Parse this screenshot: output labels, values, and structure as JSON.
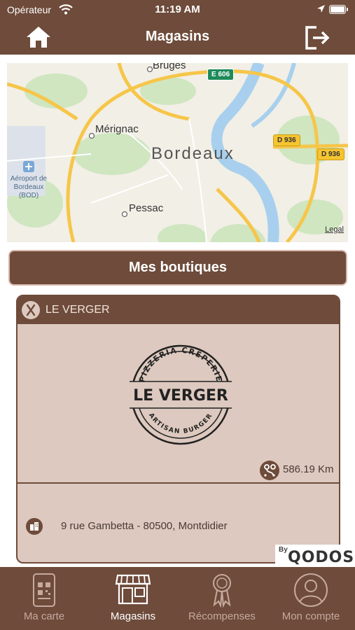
{
  "status_bar": {
    "carrier": "Opérateur",
    "time": "11:19 AM"
  },
  "header": {
    "title": "Magasins"
  },
  "map": {
    "cities": {
      "big": "Bordeaux",
      "merignac": "Mérignac",
      "pessac": "Pessac",
      "bruges": "Bruges"
    },
    "airport_label": "Aéroport de Bordeaux (BOD)",
    "roads": {
      "e606": "E 606",
      "d936_a": "D 936",
      "d936_b": "D 936"
    },
    "legal": "Legal"
  },
  "mes_boutiques_label": "Mes boutiques",
  "store": {
    "name": "LE VERGER",
    "logo": {
      "top": "PIZZERIA CRÊPERIE",
      "main": "LE VERGER",
      "bottom": "ARTISAN BURGER"
    },
    "distance": "586.19 Km",
    "address": "9 rue Gambetta - 80500, Montdidier"
  },
  "watermark": {
    "by": "By",
    "brand": "QODOS"
  },
  "tabs": [
    {
      "label": "Ma carte",
      "icon": "qr-card-icon"
    },
    {
      "label": "Magasins",
      "icon": "store-icon"
    },
    {
      "label": "Récompenses",
      "icon": "medal-icon"
    },
    {
      "label": "Mon compte",
      "icon": "user-icon"
    }
  ],
  "colors": {
    "brand": "#6e4b3a",
    "card": "#ddc9bf",
    "accent_light": "#d9b8ae"
  }
}
